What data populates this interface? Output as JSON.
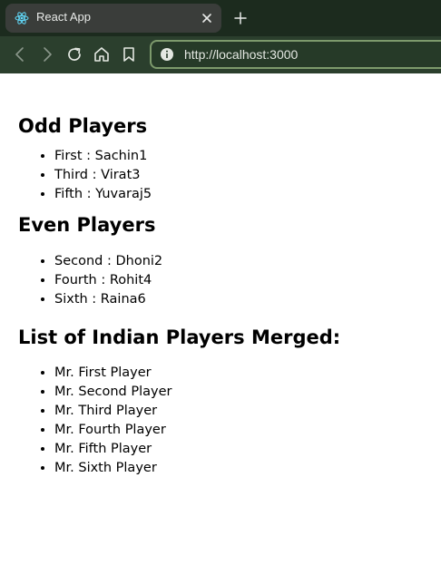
{
  "browser": {
    "tab_title": "React App",
    "url": "http://localhost:3000"
  },
  "odd": {
    "heading": "Odd Players",
    "items": [
      "First : Sachin1",
      "Third : Virat3",
      "Fifth : Yuvaraj5"
    ]
  },
  "even": {
    "heading": "Even Players",
    "items": [
      "Second : Dhoni2",
      "Fourth : Rohit4",
      "Sixth : Raina6"
    ]
  },
  "merged": {
    "heading": "List of Indian Players Merged:",
    "items": [
      "Mr. First Player",
      "Mr. Second Player",
      "Mr. Third Player",
      "Mr. Fourth Player",
      "Mr. Fifth Player",
      "Mr. Sixth Player"
    ]
  },
  "colors": {
    "tabstrip": "#1c2b1e",
    "toolbar": "#2b3f2d",
    "urlbar_border": "#7d9a6c",
    "react_blue": "#61dafb"
  },
  "icons": {
    "favicon": "react-logo-icon",
    "close": "close-icon",
    "new_tab": "plus-icon",
    "back": "back-arrow-icon",
    "forward": "forward-arrow-icon",
    "reload": "reload-icon",
    "home": "home-icon",
    "bookmark": "bookmark-icon",
    "site_info": "info-icon"
  }
}
